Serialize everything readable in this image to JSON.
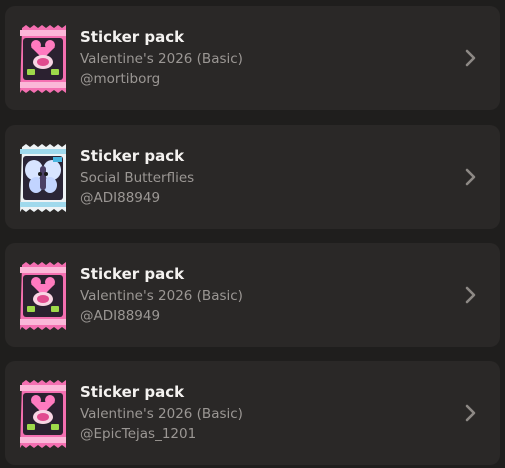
{
  "packs": [
    {
      "title": "Sticker pack",
      "subtitle": "Valentine's 2026 (Basic)",
      "author": "@mortiborg",
      "thumbnail": "valentine-pack-icon"
    },
    {
      "title": "Sticker pack",
      "subtitle": "Social Butterflies",
      "author": "@ADI88949",
      "thumbnail": "social-butterflies-pack-icon"
    },
    {
      "title": "Sticker pack",
      "subtitle": "Valentine's 2026 (Basic)",
      "author": "@ADI88949",
      "thumbnail": "valentine-pack-icon"
    },
    {
      "title": "Sticker pack",
      "subtitle": "Valentine's 2026 (Basic)",
      "author": "@EpicTejas_1201",
      "thumbnail": "valentine-pack-icon"
    }
  ],
  "colors": {
    "background": "#1f1e1d",
    "card": "#2a2827",
    "title": "#f4f2f0",
    "secondary": "#9b9794",
    "chevron": "#8d8985",
    "valentine_pink": "#f46fb1",
    "butterfly_white": "#eef3f5"
  }
}
